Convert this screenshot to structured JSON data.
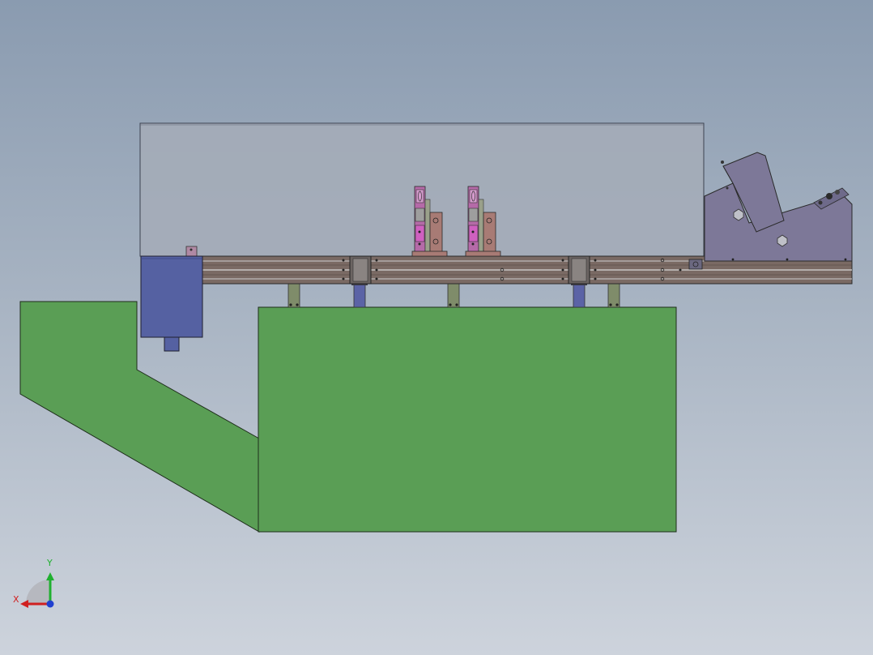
{
  "triad": {
    "x_label": "X",
    "y_label": "Y",
    "x_color": "#d02020",
    "y_color": "#20b030",
    "z_color": "#2040d0"
  },
  "colors": {
    "background_top": "#8a9bb0",
    "background_bottom": "#cdd3dc",
    "table_green": "#5a9e55",
    "glass_enclosure": "#a4acb8",
    "rail_brown": "#7a6a64",
    "motor_blue": "#5561a2",
    "feeder_purple": "#7d7898",
    "cylinder_blue": "#5b63a6",
    "post_olive": "#7f8c6a",
    "fixture_magenta": "#b56aa8",
    "fixture_rose": "#a87b75"
  },
  "parts": [
    "table-base",
    "table-side-chute",
    "glass-enclosure",
    "conveyor-rail",
    "drive-motor",
    "vibratory-feeder",
    "fixture-station-1",
    "fixture-station-2",
    "support-post",
    "lift-cylinder"
  ]
}
